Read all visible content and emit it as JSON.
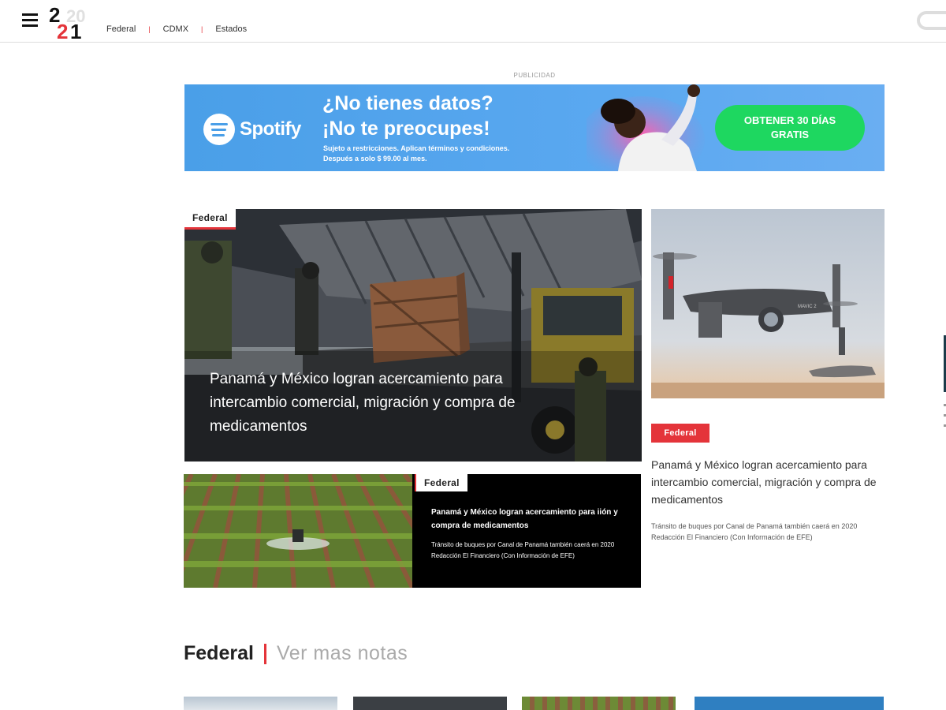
{
  "header": {
    "nav": [
      {
        "label": "Federal"
      },
      {
        "label": "CDMX"
      },
      {
        "label": "Estados"
      }
    ]
  },
  "ad": {
    "label": "PUBLICIDAD",
    "brand": "Spotify",
    "headline_1": "¿No tienes datos?",
    "headline_2": "¡No te preocupes!",
    "small_1": "Sujeto a restricciones. Aplican términos y condiciones.",
    "small_2": "Después a solo $ 99.00 al mes.",
    "cta_1": "OBTENER 30 DÍAS",
    "cta_2": "GRATIS"
  },
  "featured": {
    "tag": "Federal",
    "title": "Panamá y México logran acercamiento para intercambio comercial, migración y compra de medicamentos"
  },
  "side_story": {
    "tag": "Federal",
    "title": "Panamá y México logran acercamiento para intercambio comercial, migración y compra de medicamentos",
    "desc": "Tránsito de buques por Canal de Panamá también caerá en 2020 Redacción El Financiero (Con Información de EFE)"
  },
  "row_story": {
    "tag": "Federal",
    "title": "Panamá y México logran acercamiento para iión y compra de medicamentos",
    "desc": "Tránsito de buques por Canal de Panamá también caerá en 2020 Redacción El Financiero (Con Información de EFE)"
  },
  "section": {
    "title": "Federal",
    "more": "Ver mas notas"
  }
}
